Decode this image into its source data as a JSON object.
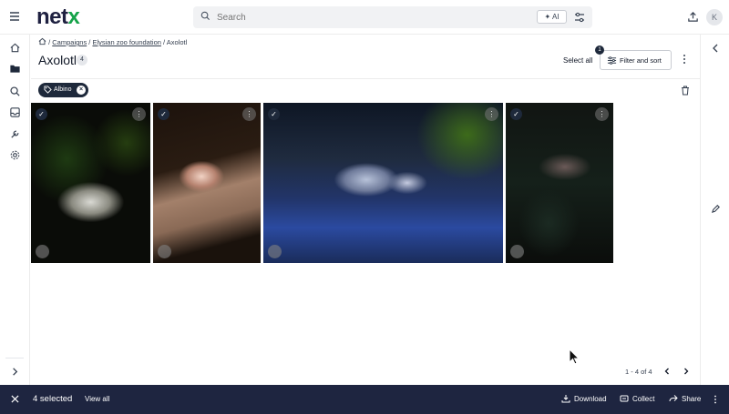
{
  "app": {
    "logo_main": "net",
    "logo_accent": "x",
    "avatar_initial": "K",
    "brand_color": "#1e2040",
    "accent_color": "#16a34a"
  },
  "search": {
    "placeholder": "Search",
    "ai_label": "AI"
  },
  "left_nav": {
    "items": [
      "home-icon",
      "folder-icon",
      "search-icon",
      "inbox-icon",
      "wrench-icon",
      "settings-icon"
    ],
    "expand_icon": "chevron-right-icon"
  },
  "breadcrumb": {
    "home_icon": "home-icon",
    "items": [
      "Campaigns",
      "Elysian zoo foundation"
    ],
    "current": "Axolotl"
  },
  "header": {
    "title": "Axolotl",
    "count": "4",
    "select_all": "Select all",
    "filter_label": "Filter and sort",
    "filter_badge": "1"
  },
  "filters": {
    "chips": [
      {
        "label": "Albino"
      }
    ]
  },
  "assets": [
    {
      "selected": true
    },
    {
      "selected": true
    },
    {
      "selected": true
    },
    {
      "selected": true
    }
  ],
  "pagination": {
    "label": "1 - 4 of 4"
  },
  "selection_bar": {
    "count_label": "4 selected",
    "view_all": "View all",
    "download": "Download",
    "collect": "Collect",
    "share": "Share",
    "background": "#1e2540"
  }
}
